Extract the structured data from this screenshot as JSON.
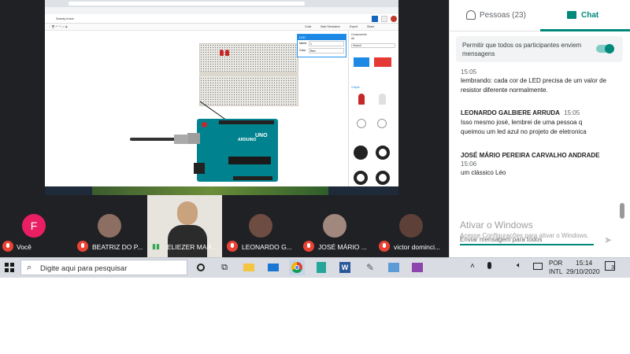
{
  "meet": {
    "participants": [
      {
        "label": "Você",
        "initial": "F"
      },
      {
        "label": "BEATRIZ DO P..."
      },
      {
        "label": "ELIEZER MAR..."
      },
      {
        "label": "LEONARDO G..."
      },
      {
        "label": "JOSÉ MÁRIO ..."
      },
      {
        "label": "victor dominci..."
      }
    ]
  },
  "shared": {
    "app_title": "Sweeky Kraub",
    "toolbar": {
      "code": "Code",
      "start": "Start Simulation",
      "export": "Export",
      "share": "Share"
    },
    "inspector": {
      "title": "LED",
      "name_label": "Name",
      "name_value": "1",
      "color_label": "Color",
      "color_value": "Red"
    },
    "components": {
      "header": "Components",
      "basic": "All",
      "search": "Search",
      "group": "Output",
      "items": [
        "DIP Switch SPST x 4",
        "DIP Switch SPST x 6",
        "LED",
        "LED RGB",
        "Light bulb",
        "NeoPixel",
        "NeoPixel Jewel",
        "NeoPixel Ring 12"
      ]
    },
    "arduino": {
      "brand": "ARDUINO",
      "model": "UNO"
    }
  },
  "chat": {
    "tab_people": "Pessoas (23)",
    "tab_chat": "Chat",
    "permission_text": "Permitir que todos os participantes enviem mensagens",
    "messages": [
      {
        "time": "15:05",
        "text": "lembrando: cada cor de LED precisa de um valor de resistor diferente normalmente."
      },
      {
        "name": "LEONARDO GALBIERE ARRUDA",
        "time": "15:05",
        "text": "Isso mesmo josé, lembrei de uma pessoa q queimou um led azul no projeto de eletronica"
      },
      {
        "name": "JOSÉ MÁRIO PEREIRA CARVALHO ANDRADE",
        "time": "15:06",
        "text": "um clássico Léo"
      }
    ],
    "activate_title": "Ativar o Windows",
    "activate_sub": "Acesse Configurações para ativar o Windows.",
    "input_placeholder": "Enviar mensagem para todos"
  },
  "taskbar": {
    "search_placeholder": "Digite aqui para pesquisar",
    "lang1": "POR",
    "lang2": "INTL",
    "time": "15:14",
    "date": "29/10/2020",
    "notifications": "3"
  },
  "colors": {
    "accent": "#00897b",
    "meet_bg": "#202124",
    "mic_off": "#ea4335"
  }
}
